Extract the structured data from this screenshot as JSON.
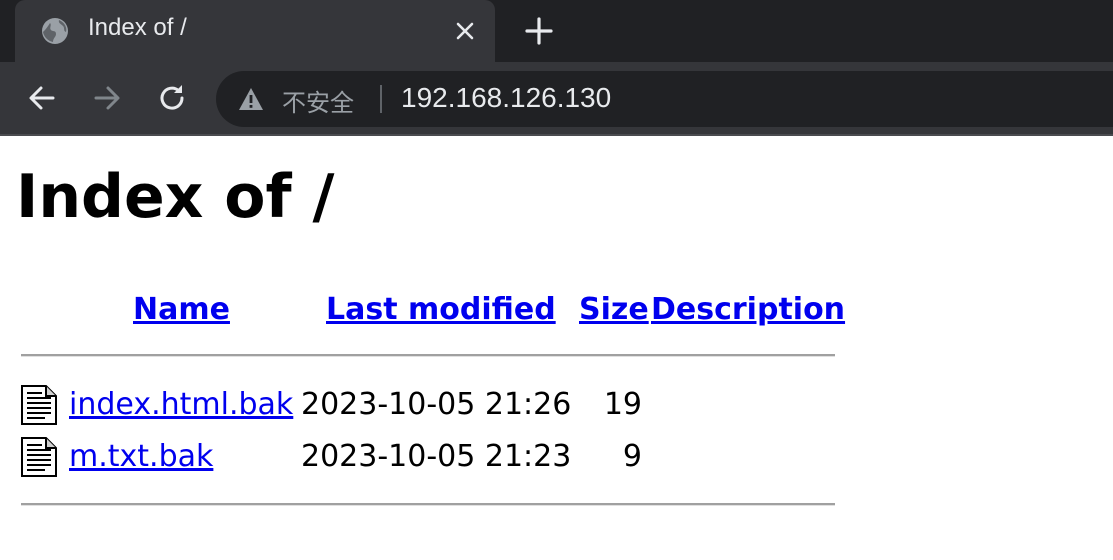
{
  "browser": {
    "tab": {
      "title": "Index of /",
      "favicon": "globe-icon",
      "close_icon": "close-icon"
    },
    "new_tab_icon": "plus-icon",
    "nav": {
      "back_icon": "arrow-left-icon",
      "forward_icon": "arrow-right-icon",
      "reload_icon": "reload-icon"
    },
    "omnibox": {
      "security_icon": "warning-icon",
      "security_label": "不安全",
      "url": "192.168.126.130"
    },
    "colors": {
      "tabstrip": "#202124",
      "toolbar": "#35363a",
      "link": "#0000ee"
    }
  },
  "page": {
    "title": "Index of /",
    "columns": [
      "Name",
      "Last modified",
      "Size",
      "Description"
    ],
    "files": [
      {
        "icon": "text-file-icon",
        "name": "index.html.bak",
        "modified": "2023-10-05 21:26",
        "size": "19",
        "description": ""
      },
      {
        "icon": "text-file-icon",
        "name": "m.txt.bak",
        "modified": "2023-10-05 21:23",
        "size": "9",
        "description": ""
      }
    ]
  }
}
